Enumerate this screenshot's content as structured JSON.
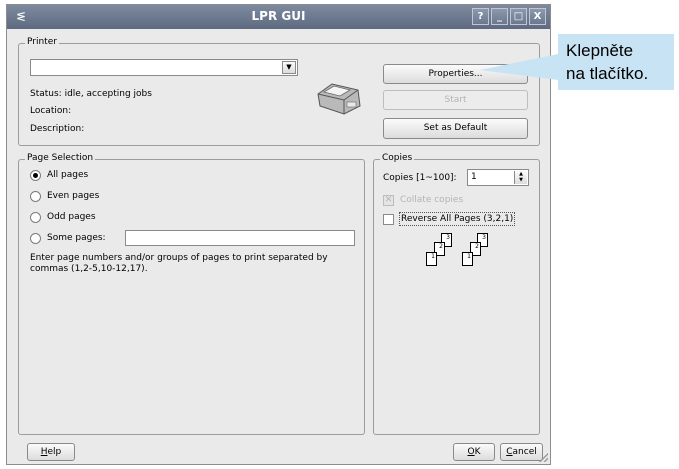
{
  "window": {
    "title": "LPR GUI",
    "controls": [
      "?",
      "_",
      "□",
      "X"
    ]
  },
  "printer_group": {
    "label": "Printer",
    "selected_printer": "",
    "status": "Status: idle, accepting jobs",
    "location": "Location:",
    "description": "Description:",
    "properties_button": "Properties...",
    "start_button": "Start",
    "set_default_button": "Set as Default"
  },
  "page_selection": {
    "label": "Page Selection",
    "options": [
      {
        "label": "All pages",
        "selected": true
      },
      {
        "label": "Even pages",
        "selected": false
      },
      {
        "label": "Odd pages",
        "selected": false
      },
      {
        "label": "Some pages:",
        "selected": false
      }
    ],
    "some_pages_value": "",
    "hint_line1": "Enter page numbers and/or groups of pages to print separated by",
    "hint_line2": "commas (1,2-5,10-12,17)."
  },
  "copies": {
    "label": "Copies",
    "copies_label": "Copies [1~100]:",
    "copies_value": "1",
    "collate_label": "Collate copies",
    "collate_checked": true,
    "collate_enabled": false,
    "reverse_label": "Reverse All Pages (3,2,1)",
    "reverse_checked": false
  },
  "footer": {
    "help_button": "Help",
    "help_mnemonic": "H",
    "help_rest": "elp",
    "ok_button": "OK",
    "ok_mnemonic": "O",
    "ok_rest": "K",
    "cancel_button": "Cancel",
    "cancel_mnemonic": "C",
    "cancel_rest": "ancel"
  },
  "callout": {
    "line1": "Klepněte",
    "line2": "na tlačítko.",
    "color": "#c8e3f3"
  },
  "icons": {
    "app": "app-icon",
    "printer": "printer-icon"
  }
}
